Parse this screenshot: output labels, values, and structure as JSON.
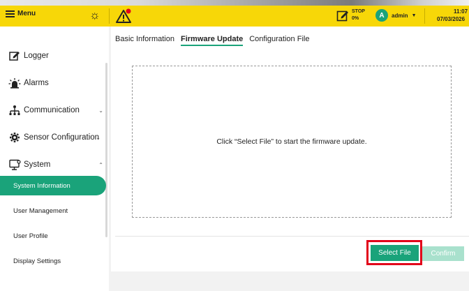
{
  "header": {
    "menu_label": "Menu",
    "status_title": "STOP",
    "status_value": "0%",
    "user_initial": "A",
    "user_name": "admin",
    "time": "11:07",
    "date": "07/03/2026"
  },
  "sidebar": {
    "items": [
      {
        "label": "Logger",
        "icon": "logger-icon"
      },
      {
        "label": "Alarms",
        "icon": "alarm-icon"
      },
      {
        "label": "Communication",
        "icon": "network-icon"
      },
      {
        "label": "Sensor Configuration",
        "icon": "gear-icon"
      },
      {
        "label": "System",
        "icon": "monitor-icon"
      }
    ],
    "subitems": [
      {
        "label": "System Information",
        "active": true
      },
      {
        "label": "User Management",
        "active": false
      },
      {
        "label": "User Profile",
        "active": false
      },
      {
        "label": "Display Settings",
        "active": false
      }
    ]
  },
  "main": {
    "tabs": [
      {
        "label": "Basic Information",
        "active": false
      },
      {
        "label": "Firmware Update",
        "active": true
      },
      {
        "label": "Configuration File",
        "active": false
      }
    ],
    "dropzone_text": "Click “Select File” to start the firmware update.",
    "select_button": "Select File",
    "confirm_button": "Confirm"
  },
  "colors": {
    "header": "#f7d708",
    "accent": "#1aa37a",
    "highlight": "#e2001a"
  }
}
